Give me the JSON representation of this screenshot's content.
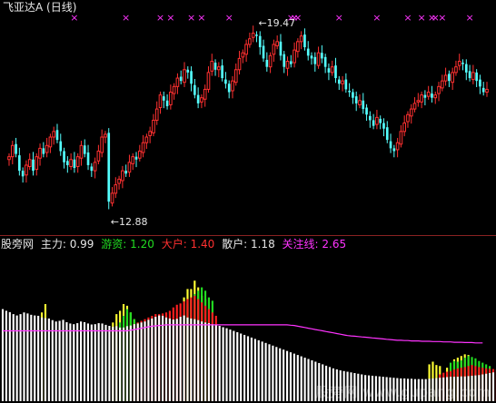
{
  "header": {
    "title": "飞亚达A (日线)"
  },
  "indicator_bar": {
    "name": "股旁网",
    "items": [
      {
        "label": "主力:",
        "value": "0.99",
        "color": "#ffffff"
      },
      {
        "label": "游资:",
        "value": "1.20",
        "color": "#22dd22"
      },
      {
        "label": "大户:",
        "value": "1.40",
        "color": "#ff3030"
      },
      {
        "label": "散户:",
        "value": "1.18",
        "color": "#ffffff"
      },
      {
        "label": "关注线:",
        "value": "2.65",
        "color": "#ff33ff"
      }
    ]
  },
  "annotations": {
    "high": "19.47",
    "low": "12.88"
  },
  "watermark": "股旁网 www.gupang.com",
  "colors": {
    "up": "#ff3030",
    "down": "#54ffff",
    "signal": "#ff33ff",
    "white_bar": "#ffffff",
    "yellow": "#ffff33",
    "green": "#22dd22",
    "red": "#ff2020",
    "focus_line": "#ff33ff"
  },
  "chart_data": [
    {
      "type": "candlestick",
      "title": "飞亚达A (日线)",
      "ylim": [
        12.4,
        19.9
      ],
      "annotations": [
        {
          "text": "19.47",
          "kind": "high",
          "index": 72
        },
        {
          "text": "12.88",
          "kind": "low",
          "index": 29
        }
      ],
      "signal_marks": [
        19,
        34,
        44,
        47,
        53,
        56,
        64,
        82,
        83,
        84,
        96,
        107,
        116,
        120,
        123,
        124,
        126,
        134
      ],
      "closes": [
        14.9,
        15.3,
        15.0,
        14.4,
        14.2,
        14.6,
        14.8,
        14.4,
        14.9,
        15.2,
        15.0,
        15.3,
        15.6,
        15.8,
        15.5,
        15.1,
        14.7,
        14.6,
        14.8,
        14.5,
        14.9,
        15.3,
        15.0,
        14.6,
        14.4,
        14.7,
        15.1,
        15.6,
        15.7,
        13.3,
        13.6,
        13.9,
        14.1,
        14.4,
        14.3,
        14.7,
        14.9,
        14.8,
        15.1,
        15.4,
        15.6,
        15.8,
        16.2,
        16.6,
        17.1,
        16.9,
        16.7,
        17.2,
        17.4,
        17.7,
        17.6,
        18.0,
        17.9,
        17.5,
        17.1,
        16.8,
        17.0,
        17.3,
        17.9,
        18.3,
        18.0,
        18.1,
        17.7,
        17.5,
        17.2,
        17.6,
        18.0,
        18.4,
        18.6,
        18.9,
        19.1,
        19.3,
        19.2,
        18.8,
        18.4,
        18.1,
        18.5,
        18.9,
        19.0,
        18.5,
        18.1,
        18.3,
        18.2,
        18.7,
        19.0,
        19.2,
        18.8,
        18.5,
        18.4,
        18.2,
        18.6,
        18.4,
        18.1,
        17.9,
        18.1,
        17.7,
        17.5,
        17.6,
        17.3,
        17.2,
        17.0,
        16.8,
        16.9,
        16.6,
        16.4,
        16.2,
        16.0,
        16.3,
        16.1,
        15.9,
        15.5,
        15.2,
        15.1,
        15.4,
        15.8,
        16.1,
        16.4,
        16.6,
        16.8,
        16.9,
        17.1,
        17.0,
        17.2,
        17.0,
        17.1,
        17.4,
        17.6,
        17.8,
        17.6,
        17.9,
        18.1,
        18.3,
        18.2,
        17.9,
        17.7,
        17.9,
        17.6,
        17.4,
        17.2,
        17.3
      ]
    },
    {
      "type": "bar",
      "title": "股旁网",
      "ylim": [
        0,
        4.5
      ],
      "series": [
        {
          "name": "主力",
          "value": 0.99
        },
        {
          "name": "游资",
          "value": 1.2
        },
        {
          "name": "大户",
          "value": 1.4
        },
        {
          "name": "散户",
          "value": 1.18
        },
        {
          "name": "关注线",
          "value": 2.65
        }
      ],
      "white": [
        2.75,
        2.7,
        2.66,
        2.6,
        2.56,
        2.6,
        2.65,
        2.62,
        2.58,
        2.56,
        2.55,
        2.5,
        2.48,
        2.47,
        2.42,
        2.38,
        2.4,
        2.43,
        2.36,
        2.32,
        2.3,
        2.33,
        2.38,
        2.36,
        2.32,
        2.29,
        2.3,
        2.33,
        2.32,
        2.28,
        2.25,
        2.22,
        2.24,
        2.2,
        2.2,
        2.24,
        2.26,
        2.3,
        2.32,
        2.35,
        2.38,
        2.43,
        2.47,
        2.52,
        2.56,
        2.55,
        2.5,
        2.47,
        2.44,
        2.46,
        2.52,
        2.56,
        2.5,
        2.47,
        2.45,
        2.42,
        2.38,
        2.35,
        2.33,
        2.3,
        2.28,
        2.25,
        2.21,
        2.18,
        2.14,
        2.1,
        2.06,
        2.02,
        1.98,
        1.94,
        1.9,
        1.86,
        1.82,
        1.78,
        1.74,
        1.7,
        1.66,
        1.62,
        1.58,
        1.54,
        1.5,
        1.46,
        1.42,
        1.38,
        1.34,
        1.3,
        1.26,
        1.22,
        1.18,
        1.14,
        1.1,
        1.06,
        1.02,
        0.98,
        0.95,
        0.92,
        0.9,
        0.88,
        0.86,
        0.84,
        0.82,
        0.8,
        0.78,
        0.77,
        0.76,
        0.75,
        0.74,
        0.73,
        0.72,
        0.71,
        0.7,
        0.69,
        0.68,
        0.68,
        0.67,
        0.67,
        0.66,
        0.66,
        0.66,
        0.66,
        0.67,
        0.68,
        0.69,
        0.7,
        0.71,
        0.72,
        0.73,
        0.73,
        0.73,
        0.74,
        0.74,
        0.75,
        0.76,
        0.77,
        0.78,
        0.8,
        0.82,
        0.84,
        0.86
      ],
      "yellow": [
        0,
        0,
        0,
        0,
        0,
        0,
        0,
        0,
        0,
        0,
        0,
        2.65,
        2.9,
        0,
        0,
        0,
        0,
        0,
        0,
        0,
        0,
        0,
        0,
        0,
        0,
        0,
        0,
        0,
        0,
        0,
        0,
        2.35,
        2.6,
        2.7,
        2.9,
        2.85,
        2.65,
        2.45,
        0,
        0,
        0,
        0,
        0,
        0,
        0,
        0,
        0,
        0,
        0,
        0,
        0,
        3.1,
        3.35,
        3.35,
        3.6,
        3.4,
        3.15,
        3.05,
        0,
        0,
        0,
        0,
        0,
        0,
        0,
        0,
        0,
        0,
        0,
        0,
        0,
        0,
        0,
        0,
        0,
        0,
        0,
        0,
        0,
        0,
        0,
        0,
        0,
        0,
        0,
        0,
        0,
        0,
        0,
        0,
        0,
        0,
        0,
        0,
        0,
        0,
        0,
        0,
        0,
        0,
        0,
        0,
        0,
        0,
        0,
        0,
        0,
        0,
        0,
        0,
        0,
        0,
        0,
        0,
        0,
        0,
        0,
        0,
        0,
        0,
        1.1,
        1.18,
        1.08,
        1.05,
        0,
        1.0,
        0,
        1.25,
        1.3,
        1.35,
        1.4,
        1.38,
        0,
        0,
        0,
        0,
        0,
        0,
        0,
        0,
        0
      ],
      "green": [
        0,
        0,
        0,
        0,
        0,
        0,
        0,
        0,
        0,
        0,
        0,
        0,
        0,
        0,
        0,
        0,
        0,
        0,
        0,
        0,
        0,
        0,
        0,
        0,
        0,
        0,
        0,
        0,
        0,
        0,
        0,
        0,
        0,
        2.35,
        2.55,
        2.75,
        2.65,
        2.45,
        2.35,
        0,
        0,
        0,
        0,
        0,
        0,
        0,
        0,
        0,
        0,
        0,
        0,
        0,
        2.9,
        3.0,
        3.2,
        3.3,
        3.4,
        3.3,
        3.1,
        3.0,
        0,
        0,
        0,
        0,
        0,
        0,
        0,
        0,
        0,
        0,
        0,
        0,
        0,
        0,
        0,
        0,
        0,
        0,
        0,
        0,
        0,
        0,
        0,
        0,
        0,
        0,
        0,
        0,
        0,
        0,
        0,
        0,
        0,
        0,
        0,
        0,
        0,
        0,
        0,
        0,
        0,
        0,
        0,
        0,
        0,
        0,
        0,
        0,
        0,
        0,
        0,
        0,
        0,
        0,
        0,
        0,
        0,
        0,
        0,
        0,
        0,
        0,
        0,
        0,
        0,
        0,
        1.15,
        1.2,
        1.18,
        1.22,
        1.3,
        1.35,
        1.32,
        1.28,
        1.2,
        1.15,
        1.1,
        1.05,
        0,
        0
      ],
      "red": [
        0,
        0,
        0,
        0,
        0,
        0,
        0,
        0,
        0,
        0,
        0,
        0,
        0,
        0,
        0,
        0,
        0,
        0,
        0,
        0,
        0,
        0,
        0,
        0,
        0,
        0,
        0,
        0,
        0,
        0,
        0,
        0,
        0,
        0,
        0,
        0,
        0,
        2.3,
        2.35,
        2.4,
        2.45,
        2.5,
        2.55,
        2.6,
        2.6,
        2.62,
        2.65,
        2.7,
        2.8,
        2.88,
        2.92,
        2.98,
        3.05,
        3.1,
        3.15,
        3.05,
        2.95,
        2.85,
        2.75,
        2.65,
        2.55,
        0,
        0,
        0,
        0,
        0,
        0,
        0,
        0,
        0,
        0,
        0,
        0,
        0,
        0,
        0,
        0,
        0,
        0,
        0,
        0,
        0,
        0,
        0,
        0,
        0,
        0,
        0,
        0,
        0,
        0,
        0,
        0,
        0,
        0,
        0,
        0,
        0,
        0,
        0,
        0,
        0,
        0,
        0,
        0,
        0,
        0,
        0,
        0,
        0,
        0,
        0,
        0,
        0,
        0,
        0,
        0,
        0,
        0,
        0,
        0,
        0,
        0,
        0.8,
        0.85,
        0.88,
        0.9,
        0.95,
        0.98,
        1.0,
        1.02,
        1.05,
        1.08,
        1.05,
        1.02,
        1.0,
        0.98,
        0.97,
        0.96,
        0.95
      ],
      "focus_line": [
        2.1,
        2.1,
        2.1,
        2.1,
        2.1,
        2.1,
        2.1,
        2.1,
        2.1,
        2.1,
        2.1,
        2.1,
        2.1,
        2.1,
        2.1,
        2.1,
        2.1,
        2.1,
        2.1,
        2.1,
        2.1,
        2.1,
        2.1,
        2.1,
        2.1,
        2.1,
        2.1,
        2.1,
        2.1,
        2.1,
        2.1,
        2.1,
        2.1,
        2.1,
        2.1,
        2.1,
        2.12,
        2.14,
        2.16,
        2.18,
        2.2,
        2.22,
        2.24,
        2.25,
        2.26,
        2.27,
        2.28,
        2.28,
        2.28,
        2.28,
        2.28,
        2.28,
        2.28,
        2.28,
        2.28,
        2.28,
        2.28,
        2.28,
        2.28,
        2.28,
        2.28,
        2.28,
        2.28,
        2.28,
        2.28,
        2.28,
        2.28,
        2.28,
        2.28,
        2.28,
        2.28,
        2.28,
        2.28,
        2.28,
        2.28,
        2.28,
        2.28,
        2.28,
        2.28,
        2.28,
        2.28,
        2.27,
        2.26,
        2.24,
        2.22,
        2.2,
        2.18,
        2.16,
        2.14,
        2.12,
        2.1,
        2.08,
        2.06,
        2.04,
        2.02,
        2.0,
        1.98,
        1.96,
        1.95,
        1.94,
        1.93,
        1.92,
        1.91,
        1.9,
        1.89,
        1.88,
        1.87,
        1.86,
        1.85,
        1.84,
        1.83,
        1.82,
        1.82,
        1.81,
        1.81,
        1.8,
        1.8,
        1.8,
        1.79,
        1.79,
        1.79,
        1.78,
        1.78,
        1.78,
        1.77,
        1.77,
        1.77,
        1.76,
        1.76,
        1.76,
        1.75,
        1.75,
        1.75,
        1.74,
        1.74,
        1.74
      ]
    }
  ]
}
